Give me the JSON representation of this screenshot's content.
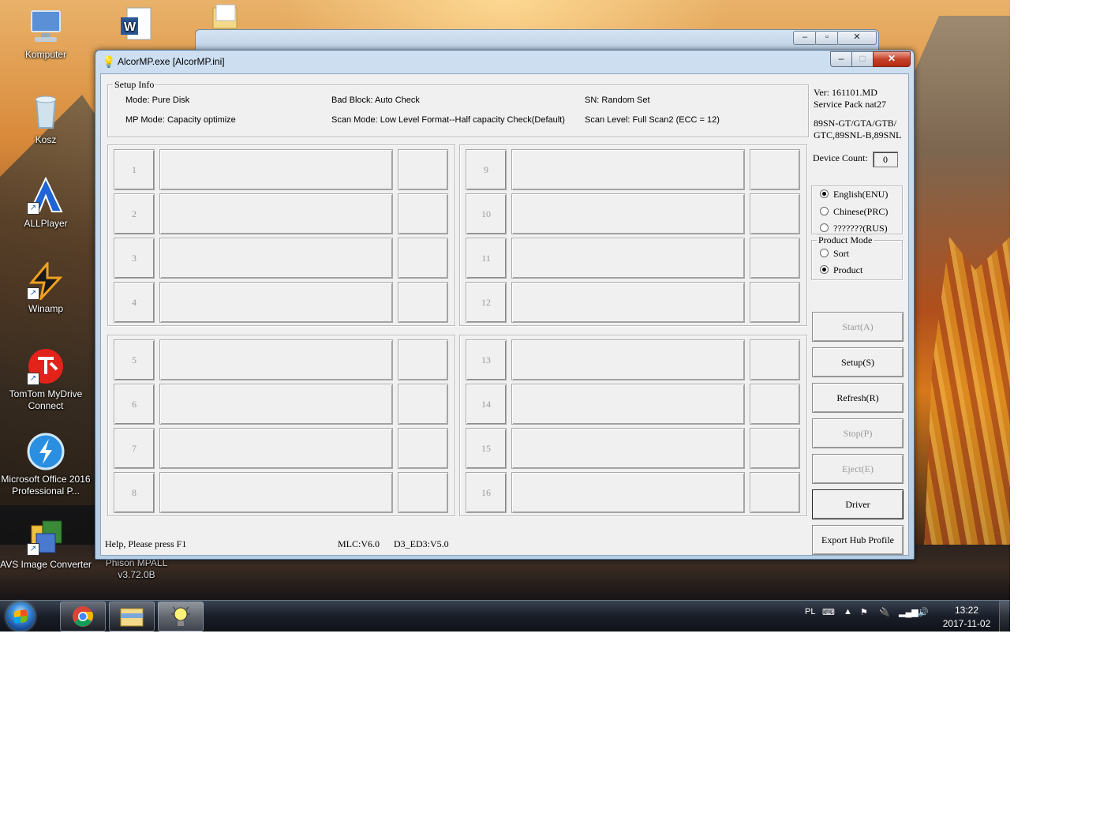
{
  "desktop": {
    "icons": [
      {
        "label": "Komputer",
        "icon": "computer-icon"
      },
      {
        "label": "Kosz",
        "icon": "recycle-bin-icon"
      },
      {
        "label": "ALLPlayer",
        "icon": "allplayer-icon"
      },
      {
        "label": "Winamp",
        "icon": "winamp-icon"
      },
      {
        "label": "TomTom MyDrive Connect",
        "icon": "tomtom-icon"
      },
      {
        "label": "Microsoft Office 2016 Professional P...",
        "icon": "office-installer-icon"
      },
      {
        "label": "AVS Image Converter",
        "icon": "avs-icon"
      }
    ],
    "second_column": [
      {
        "label": "Phison MPALL v3.72.0B",
        "icon": "phison-icon"
      }
    ]
  },
  "window": {
    "title": "AlcorMP.exe [AlcorMP.ini]",
    "min_label": "–",
    "max_label": "□",
    "close_label": "✕"
  },
  "setup_info": {
    "legend": "Setup Info",
    "mode": "Mode: Pure Disk",
    "mp_mode": "MP Mode: Capacity optimize",
    "bad_block": "Bad Block: Auto Check",
    "scan_mode": "Scan Mode: Low Level Format--Half capacity Check(Default)",
    "sn": "SN: Random Set",
    "scan_level": "Scan Level: Full Scan2 (ECC = 12)"
  },
  "version": {
    "ver": "Ver: 161101.MD",
    "service_pack": "Service Pack nat27",
    "models_1": "89SN-GT/GTA/GTB/",
    "models_2": "GTC,89SNL-B,89SNL"
  },
  "device_count": {
    "label": "Device Count:",
    "value": "0"
  },
  "language": {
    "options": [
      "English(ENU)",
      "Chinese(PRC)",
      "???????(RUS)"
    ],
    "selected": 0
  },
  "product_mode": {
    "legend": "Product Mode",
    "options": [
      "Sort",
      "Product"
    ],
    "selected": 1
  },
  "buttons": {
    "start": "Start(A)",
    "setup": "Setup(S)",
    "refresh": "Refresh(R)",
    "stop": "Stop(P)",
    "eject": "Eject(E)",
    "driver": "Driver",
    "export": "Export Hub Profile"
  },
  "ports": [
    "1",
    "2",
    "3",
    "4",
    "5",
    "6",
    "7",
    "8",
    "9",
    "10",
    "11",
    "12",
    "13",
    "14",
    "15",
    "16"
  ],
  "status": {
    "help": "Help, Please press F1",
    "mlc": "MLC:V6.0",
    "d3": "D3_ED3:V5.0"
  },
  "taskbar": {
    "apps": [
      "chrome-icon",
      "explorer-icon",
      "alcormp-icon"
    ],
    "lang": "PL",
    "time": "13:22",
    "date": "2017-11-02"
  }
}
